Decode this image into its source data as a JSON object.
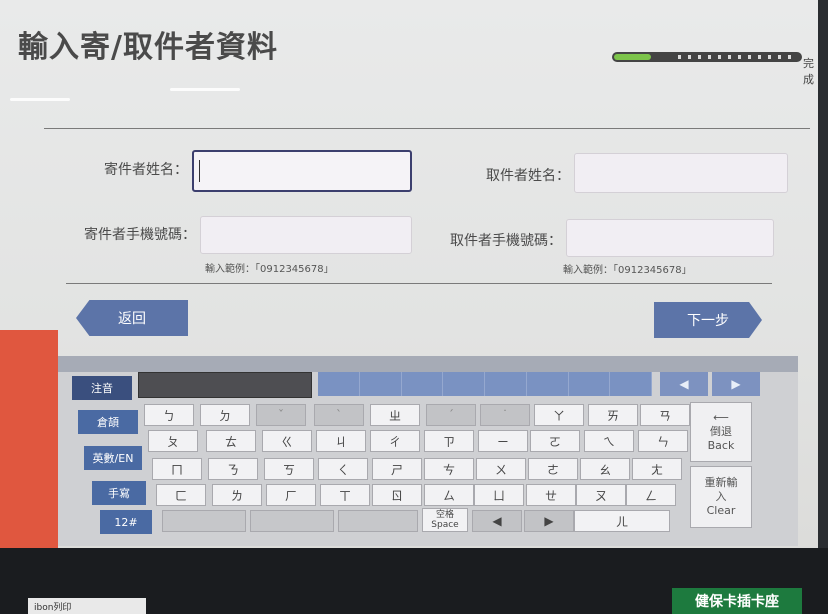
{
  "screen": {
    "title": "輸入寄/取件者資料",
    "progress": {
      "fraction": 0.2,
      "label": "完成"
    }
  },
  "form": {
    "sender_name_label": "寄件者姓名：",
    "sender_phone_label": "寄件者手機號碼：",
    "sender_phone_hint": "輸入範例：「0912345678」",
    "recipient_name_label": "取件者姓名：",
    "recipient_phone_label": "取件者手機號碼：",
    "recipient_phone_hint": "輸入範例：「0912345678」",
    "sender_name_value": "",
    "sender_phone_value": "",
    "recipient_name_value": "",
    "recipient_phone_value": ""
  },
  "nav": {
    "back_label": "返回",
    "next_label": "下一步"
  },
  "keyboard": {
    "modes": [
      "注音",
      "倉頡",
      "英數/EN",
      "手寫",
      "12#"
    ],
    "active_mode": "注音",
    "arrow_left": "◀",
    "arrow_right": "▶",
    "rows": [
      [
        "ㄅ",
        "ㄉ",
        "ˇ",
        "ˋ",
        "ㄓ",
        "ˊ",
        "˙",
        "ㄚ",
        "ㄞ",
        "ㄢ"
      ],
      [
        "ㄆ",
        "ㄊ",
        "ㄍ",
        "ㄐ",
        "ㄔ",
        "ㄗ",
        "ㄧ",
        "ㄛ",
        "ㄟ",
        "ㄣ"
      ],
      [
        "ㄇ",
        "ㄋ",
        "ㄎ",
        "ㄑ",
        "ㄕ",
        "ㄘ",
        "ㄨ",
        "ㄜ",
        "ㄠ",
        "ㄤ"
      ],
      [
        "ㄈ",
        "ㄌ",
        "ㄏ",
        "ㄒ",
        "ㄖ",
        "ㄙ",
        "ㄩ",
        "ㄝ",
        "ㄡ",
        "ㄥ"
      ]
    ],
    "space_label": "空格",
    "space_label_en": "Space",
    "left_key": "◀",
    "right_key": "▶",
    "er_key": "ㄦ",
    "backspace_label": "倒退",
    "backspace_label_en": "Back",
    "backspace_arrow": "⟵",
    "clear_label": "重新輸入",
    "clear_label_en": "Clear"
  },
  "surroundings": {
    "bottom_sign": "健保卡插卡座",
    "bottom_left_label": "ibon列印"
  }
}
